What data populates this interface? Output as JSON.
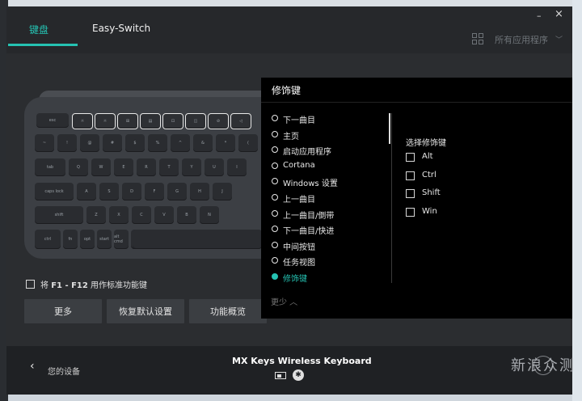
{
  "window": {
    "minimize": "–",
    "close": "×"
  },
  "tabs": [
    {
      "label": "键盘"
    },
    {
      "label": "Easy-Switch"
    }
  ],
  "apps_filter": {
    "label": "所有应用程序",
    "chevron": "﹀"
  },
  "keyboard": {
    "row0": [
      "esc",
      "☼",
      "☼",
      "⊞",
      "▤",
      "⊡",
      "◫",
      "⊘",
      "◁"
    ],
    "row1": [
      "~",
      "!",
      "@",
      "#",
      "$",
      "%",
      "^",
      "&",
      "*",
      "("
    ],
    "row2": [
      "tab",
      "Q",
      "W",
      "E",
      "R",
      "T",
      "Y",
      "U",
      "I"
    ],
    "row3": [
      "caps lock",
      "A",
      "S",
      "D",
      "F",
      "G",
      "H",
      "J"
    ],
    "row4": [
      "shift",
      "Z",
      "X",
      "C",
      "V",
      "B",
      "N"
    ],
    "row5": [
      "ctrl",
      "fn",
      "opt",
      "start",
      "alt cmd",
      "alt"
    ]
  },
  "fn_option": {
    "prefix": "将 ",
    "keys": "F1 - F12",
    "suffix": " 用作标准功能键"
  },
  "buttons": {
    "more": "更多",
    "restore": "恢复默认设置",
    "overview": "功能概览"
  },
  "panel": {
    "title": "修饰键",
    "options": [
      {
        "label": "下一曲目",
        "selected": false
      },
      {
        "label": "主页",
        "selected": false
      },
      {
        "label": "启动应用程序",
        "selected": false
      },
      {
        "label": "Cortana",
        "selected": false
      },
      {
        "label": "Windows 设置",
        "selected": false
      },
      {
        "label": "上一曲目",
        "selected": false
      },
      {
        "label": "上一曲目/倒带",
        "selected": false
      },
      {
        "label": "下一曲目/快进",
        "selected": false
      },
      {
        "label": "中间按钮",
        "selected": false
      },
      {
        "label": "任务视图",
        "selected": false
      },
      {
        "label": "修饰键",
        "selected": true
      }
    ],
    "more_label": "更少 ︿",
    "modifiers_title": "选择修饰键",
    "modifiers": [
      "Alt",
      "Ctrl",
      "Shift",
      "Win"
    ]
  },
  "bottom": {
    "back_label": "您的设备",
    "back_chevron": "‹",
    "device": "MX Keys Wireless Keyboard",
    "bt_icon": "✱"
  },
  "watermark": "新浪众测",
  "colors": {
    "accent": "#25c2b2",
    "panel": "#000000",
    "window": "#2b2d30"
  }
}
